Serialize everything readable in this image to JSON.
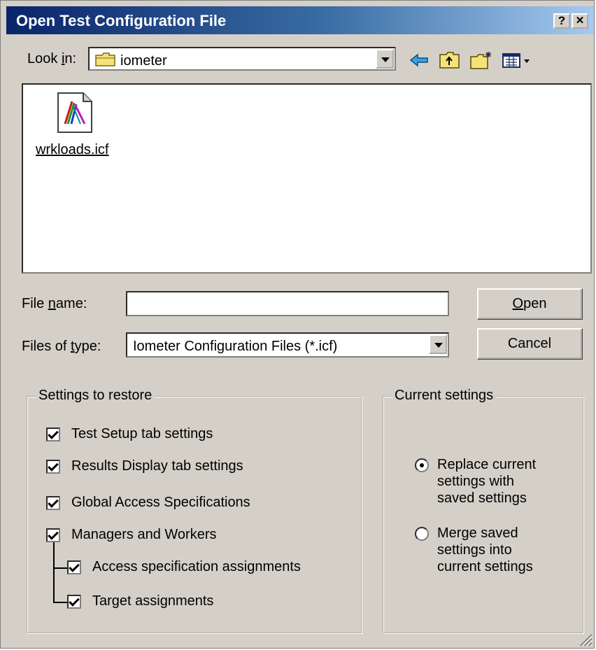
{
  "window": {
    "title": "Open Test Configuration File",
    "help_glyph": "?",
    "close_glyph": "✕"
  },
  "look_in": {
    "label_pre": "Look ",
    "label_mnemonic": "i",
    "label_post": "n:",
    "value": "iometer",
    "icons": [
      "back-arrow-icon",
      "up-folder-icon",
      "new-folder-icon",
      "view-menu-icon"
    ]
  },
  "files": [
    {
      "name": "wrkloads.icf",
      "icon": "icf-file-icon"
    }
  ],
  "file_name": {
    "label_pre": "File ",
    "label_mnemonic": "n",
    "label_post": "ame:",
    "value": ""
  },
  "file_type": {
    "label_pre": "Files of ",
    "label_mnemonic": "t",
    "label_post": "ype:",
    "value": "Iometer Configuration Files (*.icf)"
  },
  "buttons": {
    "open_mnemonic": "O",
    "open_rest": "pen",
    "cancel": "Cancel"
  },
  "settings_to_restore": {
    "title": "Settings to restore",
    "items": [
      {
        "label": "Test Setup tab settings",
        "checked": true
      },
      {
        "label": "Results Display tab settings",
        "checked": true
      },
      {
        "label": "Global Access Specifications",
        "checked": true
      },
      {
        "label": "Managers and Workers",
        "checked": true
      },
      {
        "label": "Access specification assignments",
        "checked": true
      },
      {
        "label": "Target assignments",
        "checked": true
      }
    ]
  },
  "current_settings": {
    "title": "Current settings",
    "options": [
      {
        "lines": [
          "Replace current",
          "settings with",
          "saved settings"
        ],
        "selected": true
      },
      {
        "lines": [
          "Merge saved",
          "settings into",
          "current settings"
        ],
        "selected": false
      }
    ]
  },
  "colors": {
    "titlebar_start": "#0a246a",
    "titlebar_end": "#a6caf0",
    "face": "#d4d0c8"
  }
}
